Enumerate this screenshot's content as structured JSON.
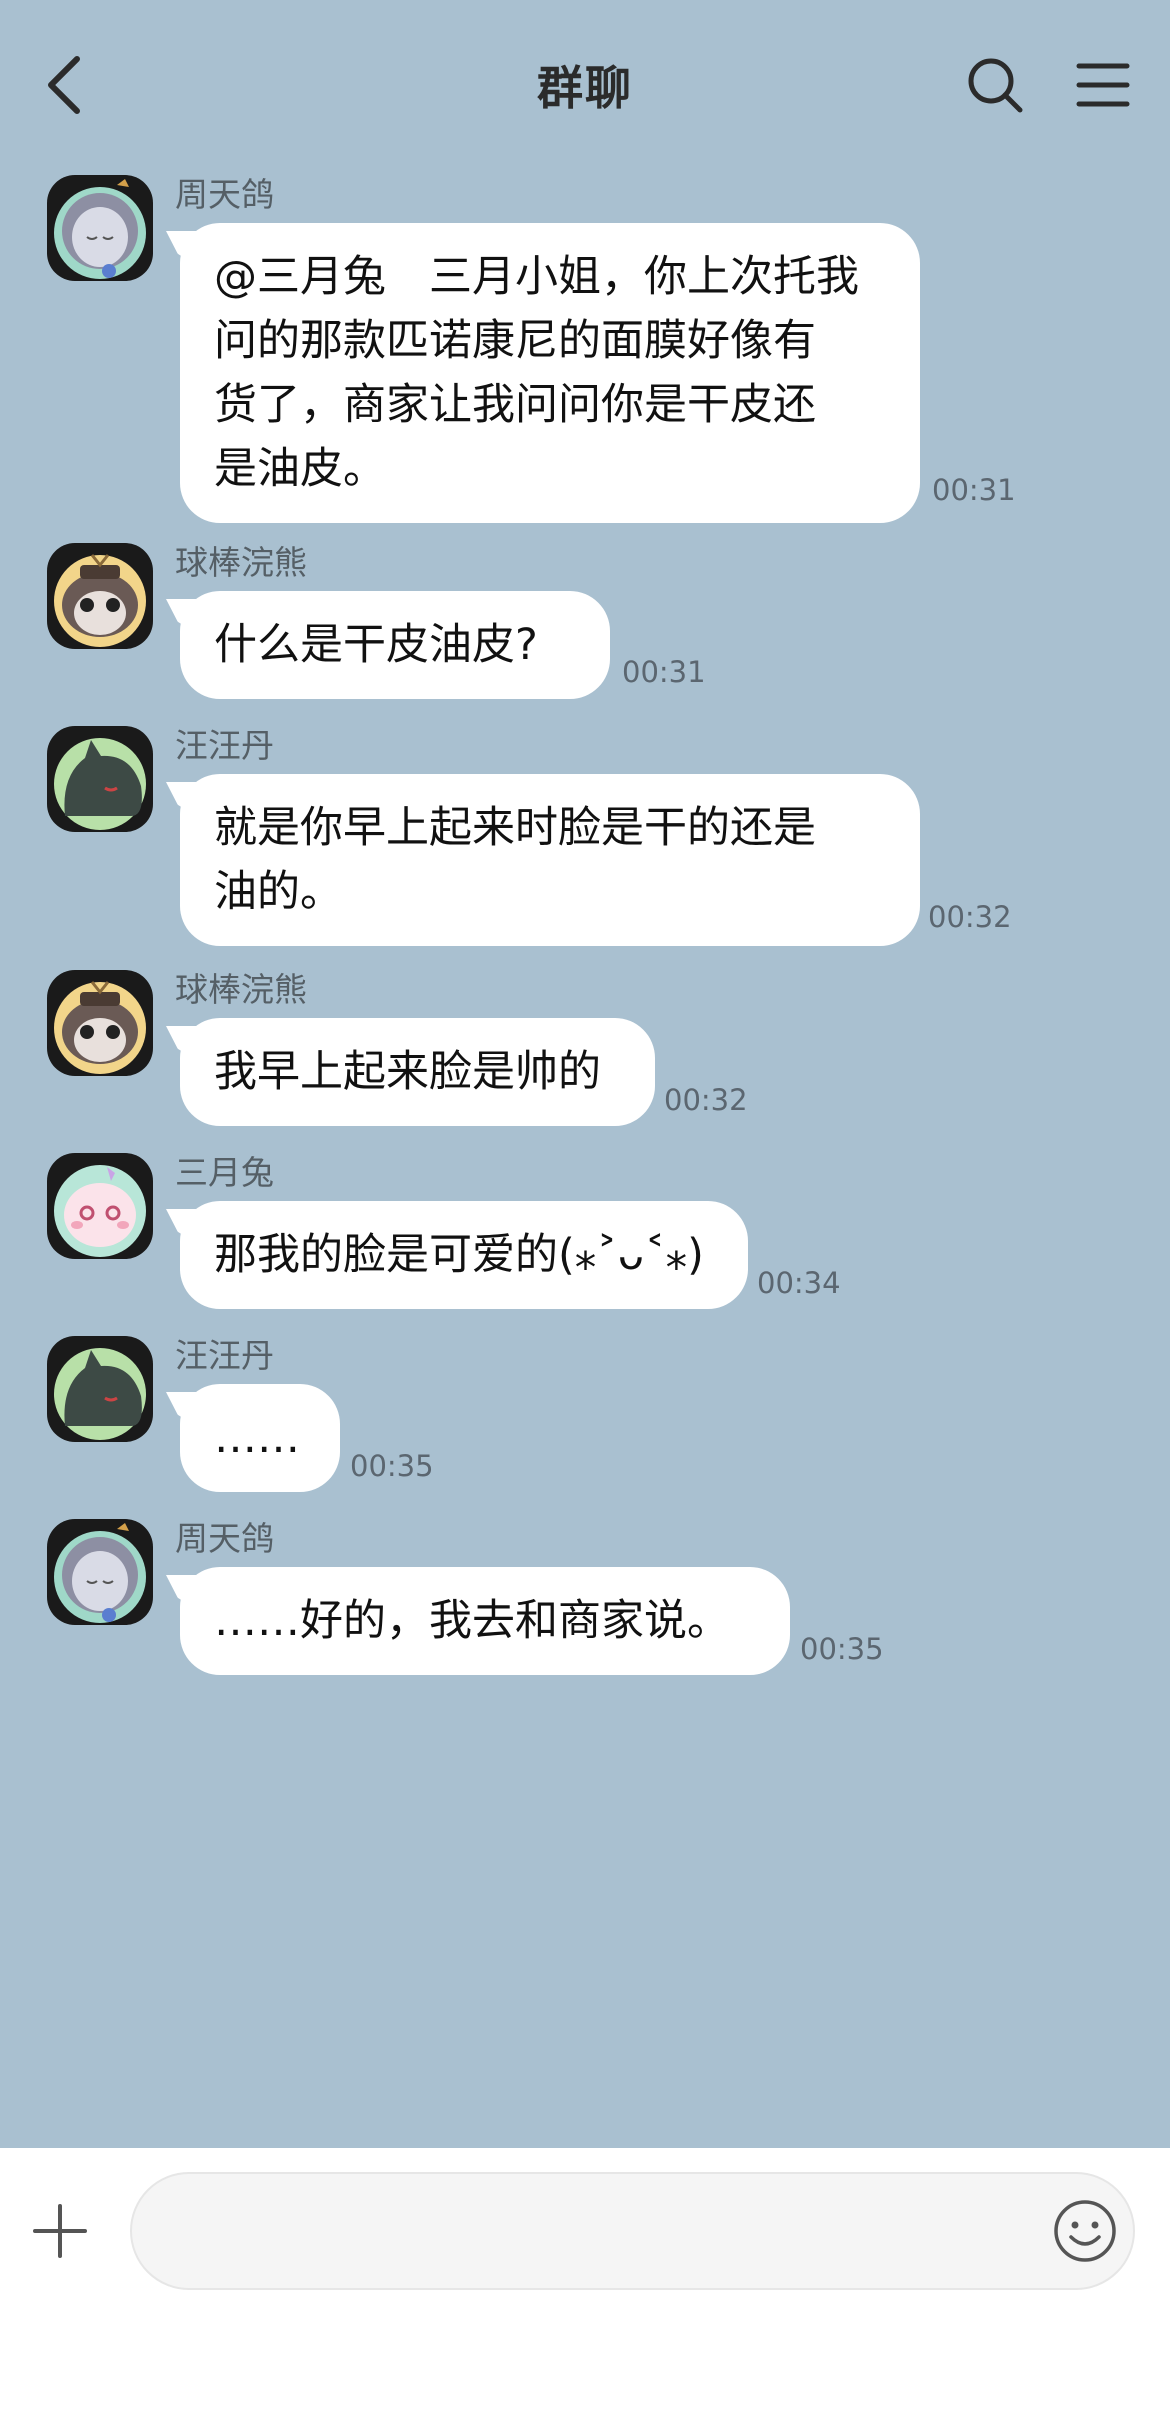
{
  "header": {
    "title": "群聊",
    "back_icon": "chevron-left-icon",
    "search_icon": "search-icon",
    "menu_icon": "hamburger-menu-icon"
  },
  "colors": {
    "chat_background": "#a9c0d0",
    "bubble": "#ffffff",
    "bottom_bar": "#ffffff"
  },
  "messages": [
    {
      "sender": "周天鸽",
      "avatar": "grey-hooded-figure-avatar",
      "lines": [
        "@三月兔　三月小姐，你上次托我",
        "问的那款匹诺康尼的面膜好像有",
        "货了，商家让我问问你是干皮还",
        "是油皮。"
      ],
      "time": "00:31"
    },
    {
      "sender": "球棒浣熊",
      "avatar": "raccoon-avatar",
      "lines": [
        "什么是干皮油皮?"
      ],
      "time": "00:31"
    },
    {
      "sender": "汪汪丹",
      "avatar": "dark-dragon-avatar",
      "lines": [
        "就是你早上起来时脸是干的还是",
        "油的。"
      ],
      "time": "00:32"
    },
    {
      "sender": "球棒浣熊",
      "avatar": "raccoon-avatar",
      "lines": [
        "我早上起来脸是帅的"
      ],
      "time": "00:32"
    },
    {
      "sender": "三月兔",
      "avatar": "pink-bunny-avatar",
      "lines": [
        "那我的脸是可爱的(⁎˃ᴗ˂⁎)"
      ],
      "time": "00:34"
    },
    {
      "sender": "汪汪丹",
      "avatar": "dark-dragon-avatar",
      "lines": [
        "……"
      ],
      "time": "00:35"
    },
    {
      "sender": "周天鸽",
      "avatar": "grey-hooded-figure-avatar",
      "lines": [
        "……好的，我去和商家说。"
      ],
      "time": "00:35"
    }
  ],
  "input_bar": {
    "plus_icon": "plus-icon",
    "value": "",
    "placeholder": "",
    "emoji_icon": "smiley-face-icon"
  }
}
